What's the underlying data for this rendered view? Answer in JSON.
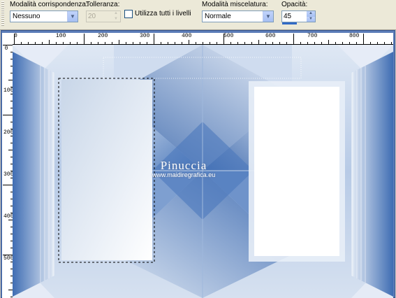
{
  "toolbar": {
    "match_mode": {
      "label": "Modalità corrispondenza:",
      "value": "Nessuno"
    },
    "tolerance": {
      "label": "Tolleranza:",
      "value": "20",
      "enabled": false
    },
    "use_all_layers": {
      "label": "Utilizza tutti i livelli",
      "checked": false
    },
    "blend_mode": {
      "label": "Modalità miscelatura:",
      "value": "Normale"
    },
    "opacity": {
      "label": "Opacità:",
      "value": "45"
    }
  },
  "rulers": {
    "horizontal": [
      "0",
      "100",
      "200",
      "300",
      "400",
      "500",
      "600",
      "700",
      "800"
    ],
    "vertical": [
      "0",
      "100",
      "200",
      "300",
      "400",
      "500"
    ]
  },
  "watermark": {
    "line1": "Pinuccia",
    "line2": "www.maidiregrafica.eu"
  },
  "colors": {
    "accent": "#316ac5",
    "canvas_light": "#e9eff8",
    "canvas_dark": "#2f5ea6",
    "panel": "#ece9d8"
  }
}
